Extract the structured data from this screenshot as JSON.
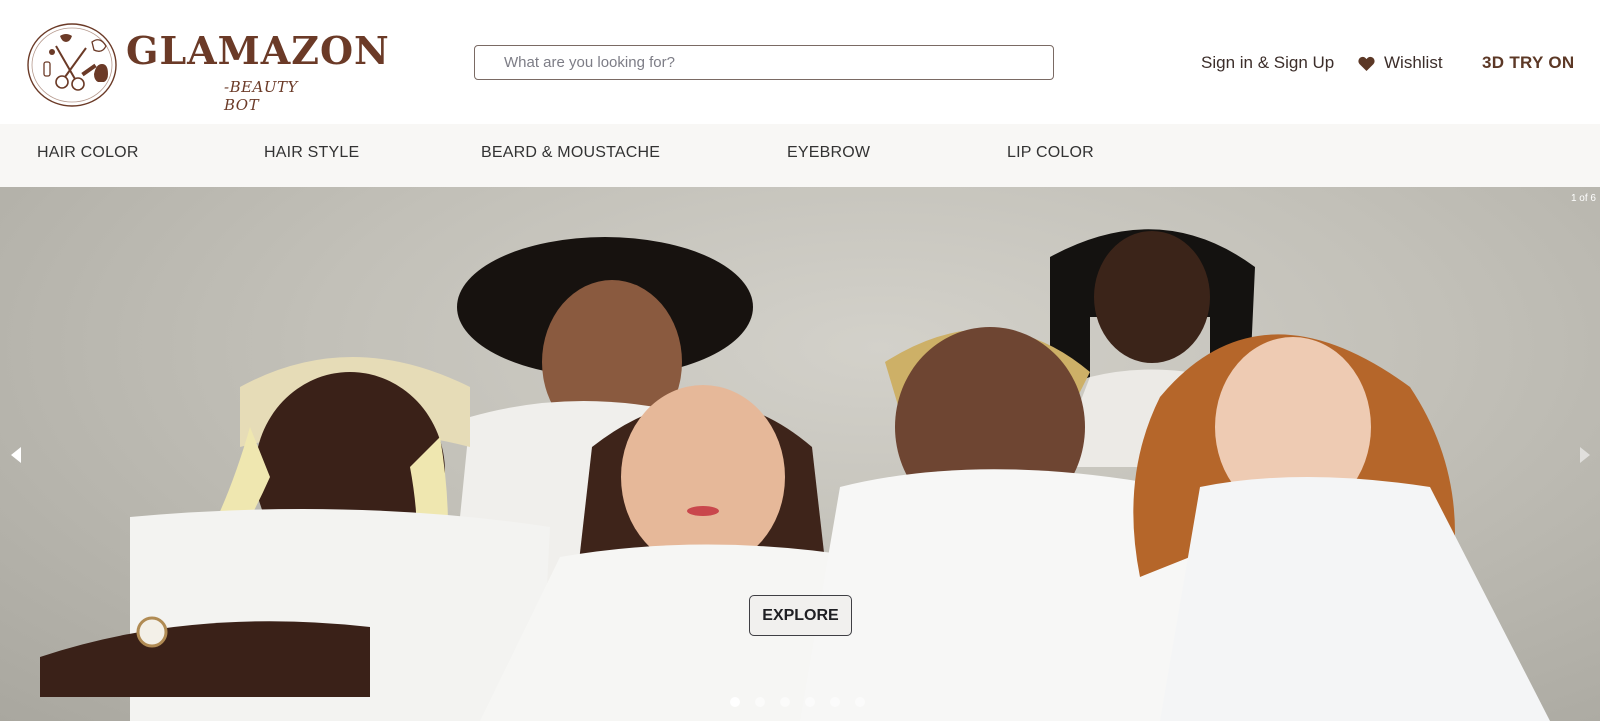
{
  "brand": {
    "name": "GLAMAZON",
    "tagline": "-BEAUTY BOT"
  },
  "search": {
    "placeholder": "What are you looking for?",
    "value": ""
  },
  "header": {
    "signin_label": "Sign in & Sign Up",
    "wishlist_label": "Wishlist",
    "tryon_label": "3D TRY ON",
    "heart_icon": "heart-icon"
  },
  "categories": [
    {
      "label": "HAIR COLOR"
    },
    {
      "label": "HAIR STYLE"
    },
    {
      "label": "BEARD & MOUSTACHE"
    },
    {
      "label": "EYEBROW"
    },
    {
      "label": "LIP COLOR"
    }
  ],
  "carousel": {
    "counter": "1 of 6",
    "explore_label": "EXPLORE",
    "current_slide": 1,
    "total_slides": 6,
    "prev_icon": "chevron-left-icon",
    "next_icon": "chevron-right-icon"
  },
  "colors": {
    "brand_brown": "#6b3a27",
    "category_bg": "#f8f7f5",
    "hero_bg": "#c2c0b8"
  }
}
